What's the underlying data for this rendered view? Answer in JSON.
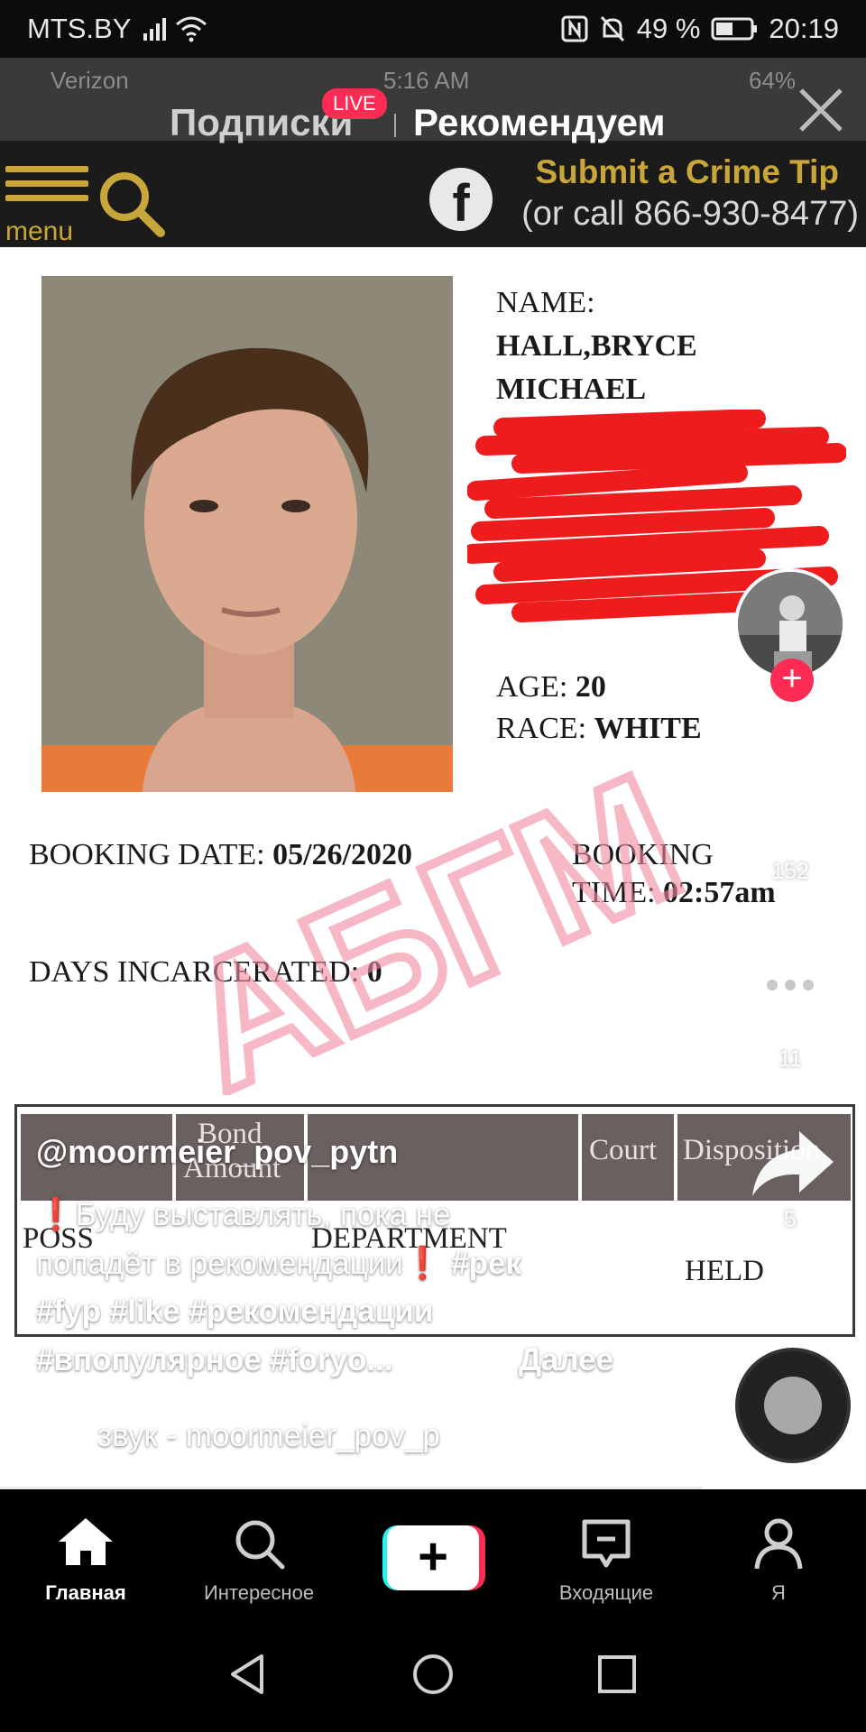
{
  "status_bar": {
    "carrier": "MTS.BY",
    "battery": "49 %",
    "time": "20:19"
  },
  "video": {
    "inner_status": {
      "carrier": "Verizon",
      "time": "5:16 AM",
      "battery": "64%"
    },
    "site": {
      "menu_label": "menu",
      "tip_title": "Submit a Crime Tip",
      "tip_phone": "(or call 866-930-8477)"
    },
    "record": {
      "name_label": "NAME:",
      "name_line1": "HALL,BRYCE",
      "name_line2": "MICHAEL",
      "age_label": "AGE:",
      "age_value": "20",
      "race_label": "RACE:",
      "race_value": "WHITE",
      "booking_date_label": "BOOKING DATE:",
      "booking_date_value": "05/26/2020",
      "booking_time_label1": "BOOKING",
      "booking_time_label2": "TIME:",
      "booking_time_value": "02:57am",
      "days_label": "DAYS INCARCERATED:",
      "days_value": "0",
      "watermark": "АБГМ"
    },
    "table": {
      "headers": [
        "Bond",
        "Amount",
        "Court",
        "Disposition"
      ],
      "cells": [
        "POSS",
        "DEPARTMENT",
        "HELD"
      ]
    }
  },
  "feed_tabs": {
    "following": "Подписки",
    "live_badge": "LIVE",
    "for_you": "Рекомендуем"
  },
  "side_actions": {
    "like_count": "152",
    "comment_count": "11",
    "share_count": "5"
  },
  "caption": {
    "username": "@moormeier_pov_pytn",
    "line1": "❗Буду выставлять, пока не",
    "line2_text": "попадёт в рекомендации❗",
    "line2_tag": "#рек",
    "line3": "#fyp #like #рекомендации",
    "line4": "#впопулярное #foryo...",
    "more": "Далее",
    "sound": "звук - moormeier_pov_p"
  },
  "bottom_nav": {
    "home": "Главная",
    "discover": "Интересное",
    "create": "+",
    "inbox": "Входящие",
    "me": "Я"
  },
  "colors": {
    "accent": "#fe2c55",
    "cyan": "#25f4ee",
    "gold": "#c9a63a"
  }
}
